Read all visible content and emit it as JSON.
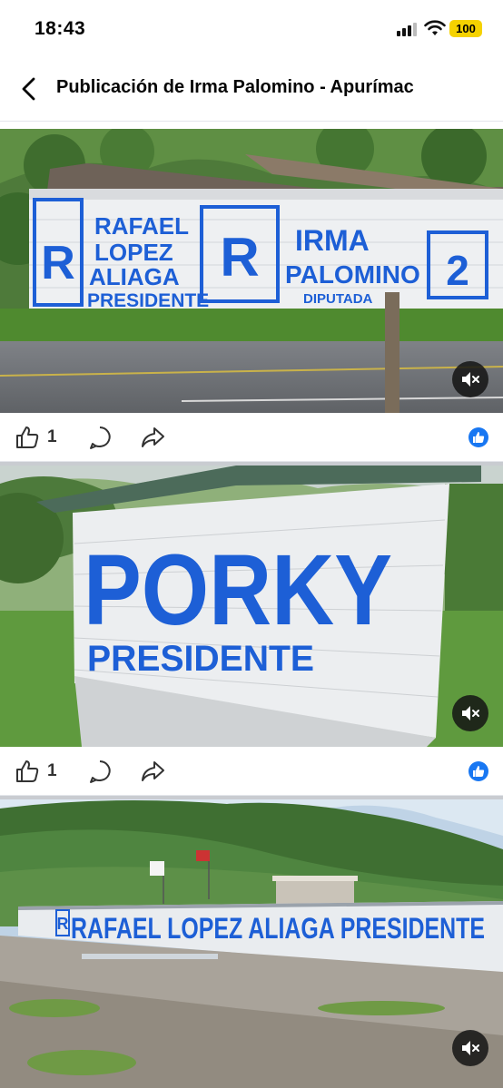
{
  "status_bar": {
    "time": "18:43",
    "battery": "100"
  },
  "header": {
    "title": "Publicación de Irma Palomino - Apurímac"
  },
  "posts": [
    {
      "wall_text": {
        "r1": "R",
        "line1": "RAFAEL",
        "line2": "LOPEZ",
        "line3": "ALIAGA",
        "line4": "PRESIDENTE",
        "r2": "R",
        "line5": "IRMA",
        "line6": "PALOMINO",
        "line7": "DIPUTADA",
        "num": "2"
      },
      "likes": "1"
    },
    {
      "wall_text": {
        "line1": "PORKY",
        "line2": "PRESIDENTE"
      },
      "likes": "1"
    },
    {
      "wall_text": {
        "r": "R",
        "line1": "RAFAEL LOPEZ ALIAGA PRESIDENTE"
      }
    }
  ],
  "colors": {
    "accent": "#1877f2",
    "wall_blue": "#1d5fd6",
    "battery": "#f5d200"
  }
}
